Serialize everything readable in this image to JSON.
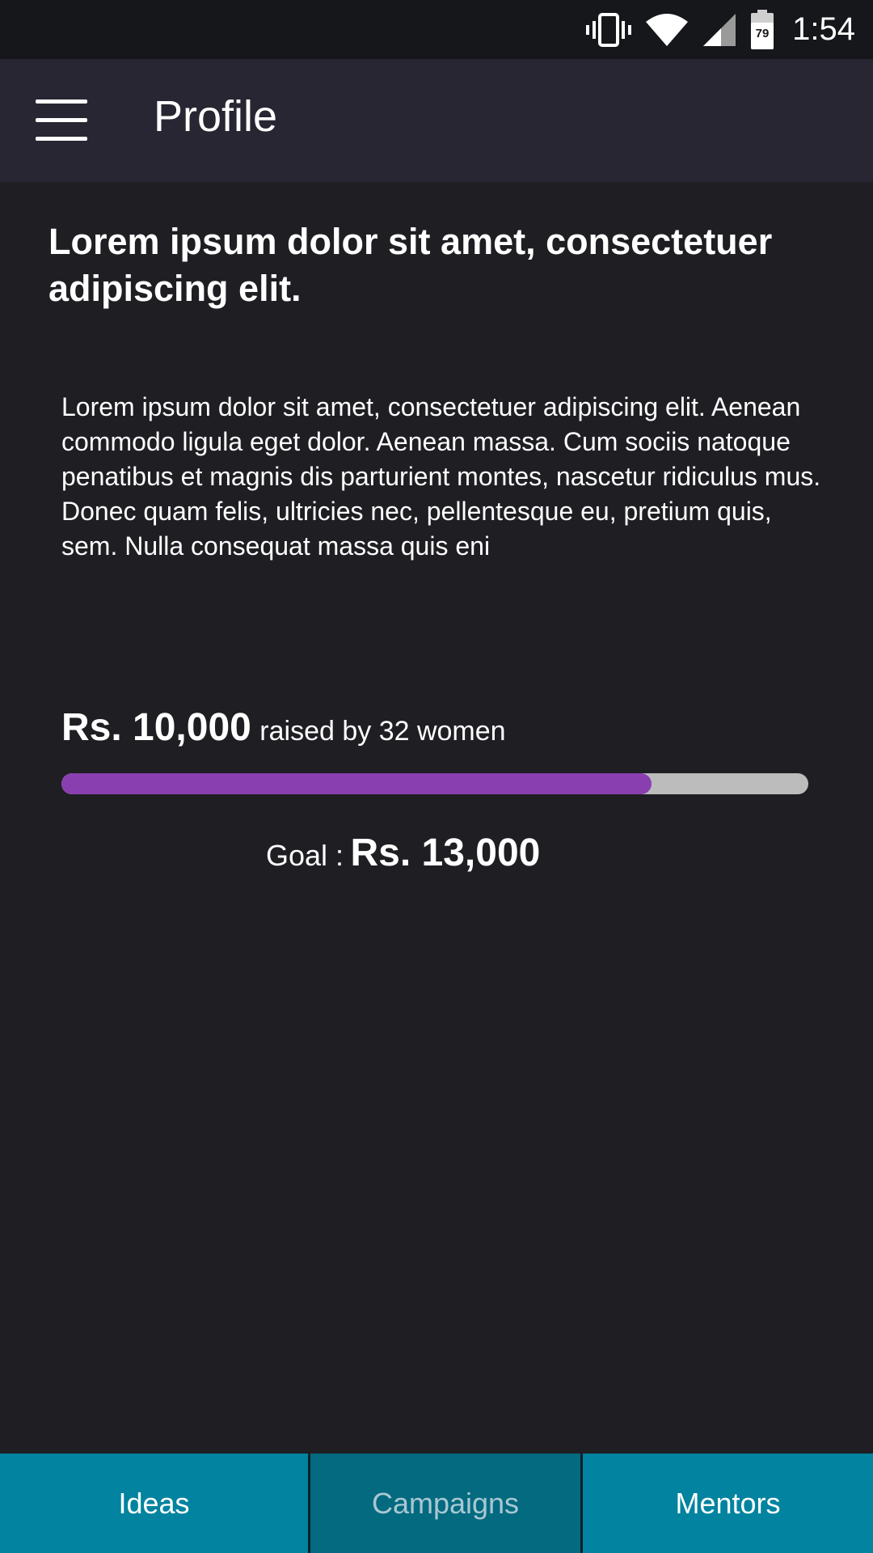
{
  "status_bar": {
    "time": "1:54",
    "battery_level": "79",
    "icons": [
      "vibrate-icon",
      "wifi-icon",
      "signal-icon",
      "battery-icon"
    ]
  },
  "app_bar": {
    "title": "Profile",
    "menu_icon": "hamburger-menu-icon"
  },
  "content": {
    "headline": "Lorem ipsum dolor sit amet, consectetuer adipiscing elit.",
    "body": "Lorem ipsum dolor sit amet, consectetuer adipiscing elit. Aenean commodo ligula eget dolor. Aenean massa. Cum sociis natoque penatibus et magnis dis parturient montes, nascetur ridiculus mus. Donec quam felis, ultricies nec, pellentesque eu, pretium quis, sem. Nulla consequat massa quis eni"
  },
  "fundraising": {
    "raised_amount": "Rs. 10,000",
    "raised_text": "raised by 32 women",
    "goal_label": "Goal :",
    "goal_amount": "Rs. 13,000",
    "progress_fraction": 0.79
  },
  "bottom_nav": {
    "tabs": [
      {
        "label": "Ideas"
      },
      {
        "label": "Campaigns",
        "active": true
      },
      {
        "label": "Mentors"
      }
    ]
  },
  "colors": {
    "background": "#1e1e23",
    "app_bar": "#272632",
    "progress_fill": "#8a3fb0",
    "progress_track": "#bcbcbc",
    "bottom_nav": "#02839f",
    "bottom_nav_active": "#036a80"
  }
}
